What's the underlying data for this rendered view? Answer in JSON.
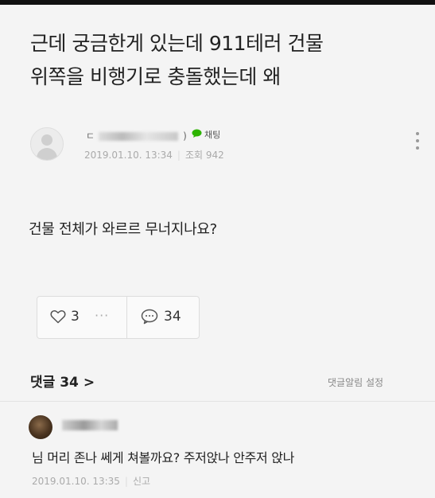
{
  "post": {
    "title_line1": "근데 궁금한게 있는데 911테러 건물",
    "title_line2": "위쪽을 비행기로 충돌했는데 왜",
    "author": {
      "name_prefix": "ㄷ",
      "name_suffix": ")",
      "chat_label": "채팅",
      "chat_color": "#2db400"
    },
    "date": "2019.01.10. 13:34",
    "views": "조회 942",
    "body": "건물 전체가 와르르 무너지나요?",
    "reactions": {
      "likes": "3",
      "more": "···",
      "comments": "34"
    }
  },
  "comments_section": {
    "header": "댓글 34",
    "chevron": ">",
    "notify_setting": "댓글알림 설정",
    "items": [
      {
        "text": "님 머리 존나 쎄게 쳐볼까요? 주저앉나 안주저 앉나",
        "date": "2019.01.10. 13:35",
        "report": "신고"
      }
    ]
  }
}
